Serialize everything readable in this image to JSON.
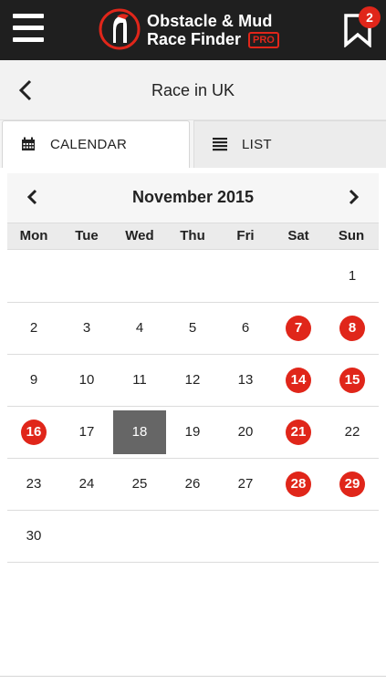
{
  "app": {
    "logo_line1": "Obstacle & Mud",
    "logo_line2": "Race Finder",
    "logo_pro": "PRO",
    "bookmark_count": "2"
  },
  "header": {
    "title": "Race in UK"
  },
  "tabs": [
    {
      "label": "CALENDAR",
      "icon": "calendar-icon",
      "active": true
    },
    {
      "label": "LIST",
      "icon": "list-icon",
      "active": false
    }
  ],
  "calendar": {
    "month_label": "November 2015",
    "weekdays": [
      "Mon",
      "Tue",
      "Wed",
      "Thu",
      "Fri",
      "Sat",
      "Sun"
    ],
    "weeks": [
      [
        "",
        "",
        "",
        "",
        "",
        "",
        "1"
      ],
      [
        "2",
        "3",
        "4",
        "5",
        "6",
        "7",
        "8"
      ],
      [
        "9",
        "10",
        "11",
        "12",
        "13",
        "14",
        "15"
      ],
      [
        "16",
        "17",
        "18",
        "19",
        "20",
        "21",
        "22"
      ],
      [
        "23",
        "24",
        "25",
        "26",
        "27",
        "28",
        "29"
      ],
      [
        "30",
        "",
        "",
        "",
        "",
        "",
        ""
      ]
    ],
    "event_days": [
      "7",
      "8",
      "14",
      "15",
      "16",
      "21",
      "28",
      "29"
    ],
    "selected_day": "18"
  },
  "colors": {
    "accent": "#e0261a",
    "topbar": "#1f1f1f",
    "selected": "#666666"
  }
}
